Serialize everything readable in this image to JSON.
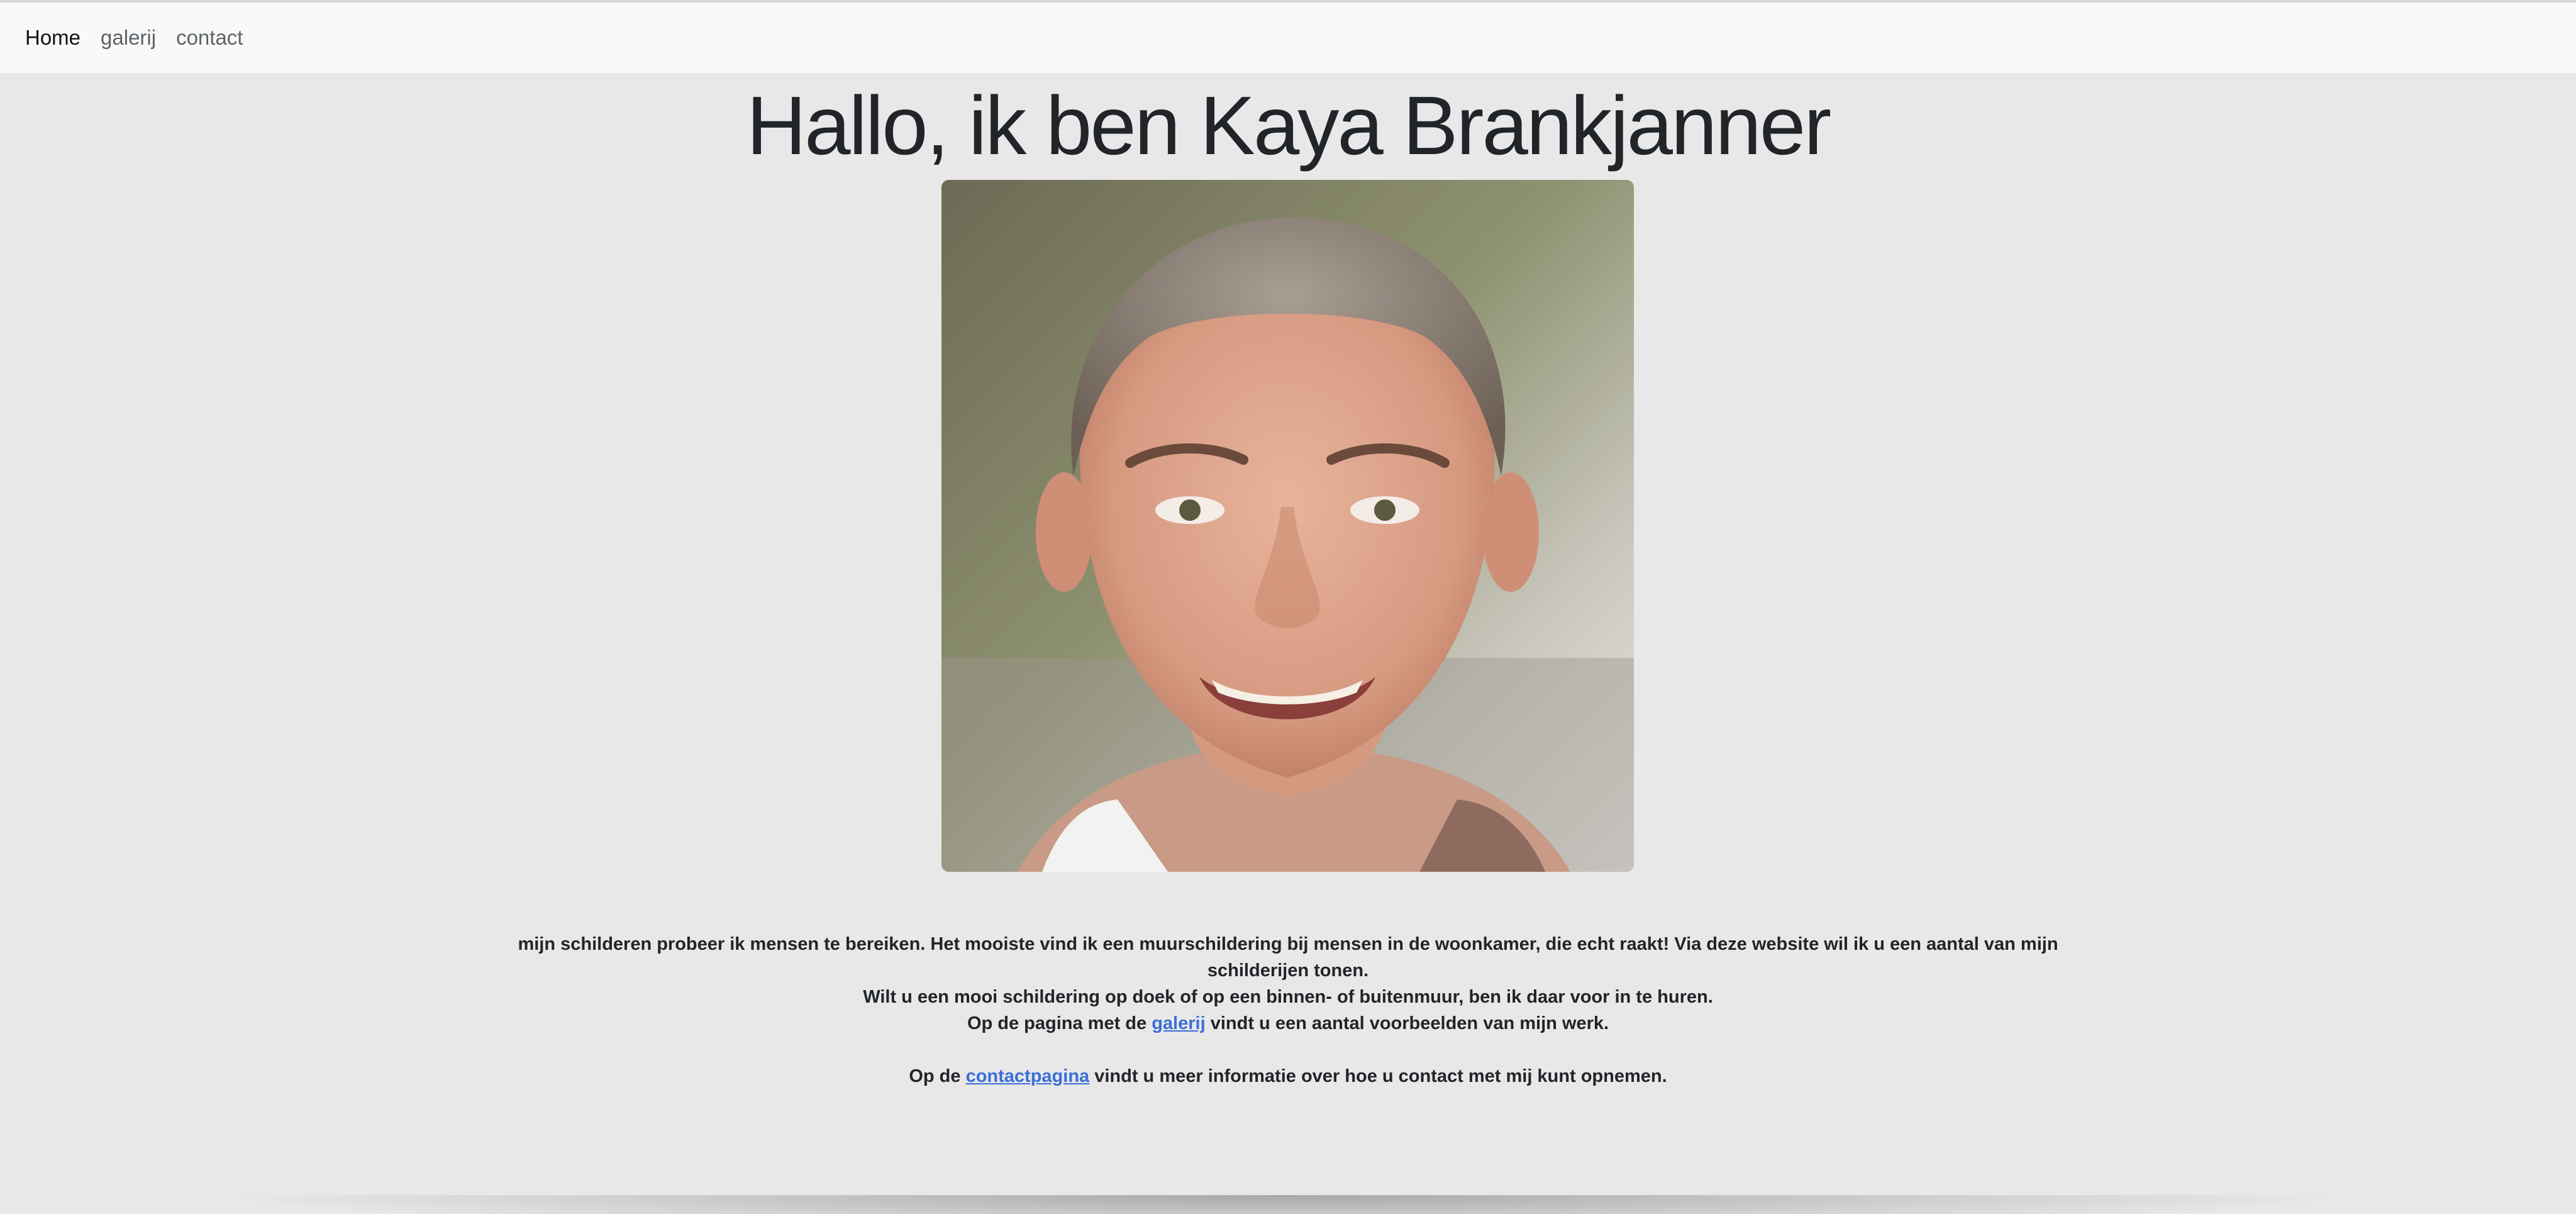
{
  "nav": {
    "items": [
      {
        "label": "Home"
      },
      {
        "label": "galerij"
      },
      {
        "label": "contact"
      }
    ]
  },
  "hero": {
    "title": "Hallo, ik ben Kaya Brankjanner"
  },
  "intro": {
    "line1": "mijn schilderen probeer ik mensen te bereiken. Het mooiste vind ik een muurschildering bij mensen in de woonkamer, die echt raakt! Via deze website wil ik u een aantal van mijn schilderijen tonen.",
    "line2": "Wilt u een mooi schildering op doek of op een binnen- of buitenmuur, ben ik daar voor in te huren.",
    "line3_before": "Op de pagina met de ",
    "line3_link": "galerij",
    "line3_after": " vindt u een aantal voorbeelden van mijn werk.",
    "line4_before": "Op de ",
    "line4_link": "contactpagina",
    "line4_after": " vindt u meer informatie over hoe u contact met mij kunt opnemen."
  },
  "colors": {
    "background": "#e8e8e8",
    "navbar": "#f8f9fa",
    "link": "#3a6fd8",
    "text": "#212529"
  }
}
